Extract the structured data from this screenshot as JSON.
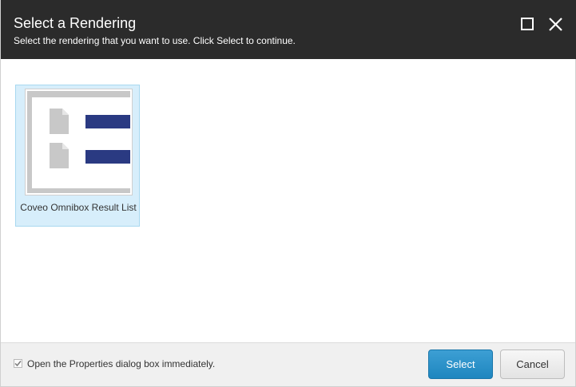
{
  "header": {
    "title": "Select a Rendering",
    "subtitle": "Select the rendering that you want to use. Click Select to continue.",
    "background": "#2b2b2b"
  },
  "window_controls": [
    {
      "icon": "maximize-icon"
    },
    {
      "icon": "close-icon"
    }
  ],
  "renderings": [
    {
      "label": "Coveo Omnibox Result List",
      "selected": true,
      "thumbnail_icon": "result-list-thumbnail-icon"
    }
  ],
  "footer": {
    "checkbox_label": "Open the Properties dialog box immediately.",
    "checkbox_checked": true,
    "select_label": "Select",
    "cancel_label": "Cancel",
    "accent": "#2a92c9"
  }
}
